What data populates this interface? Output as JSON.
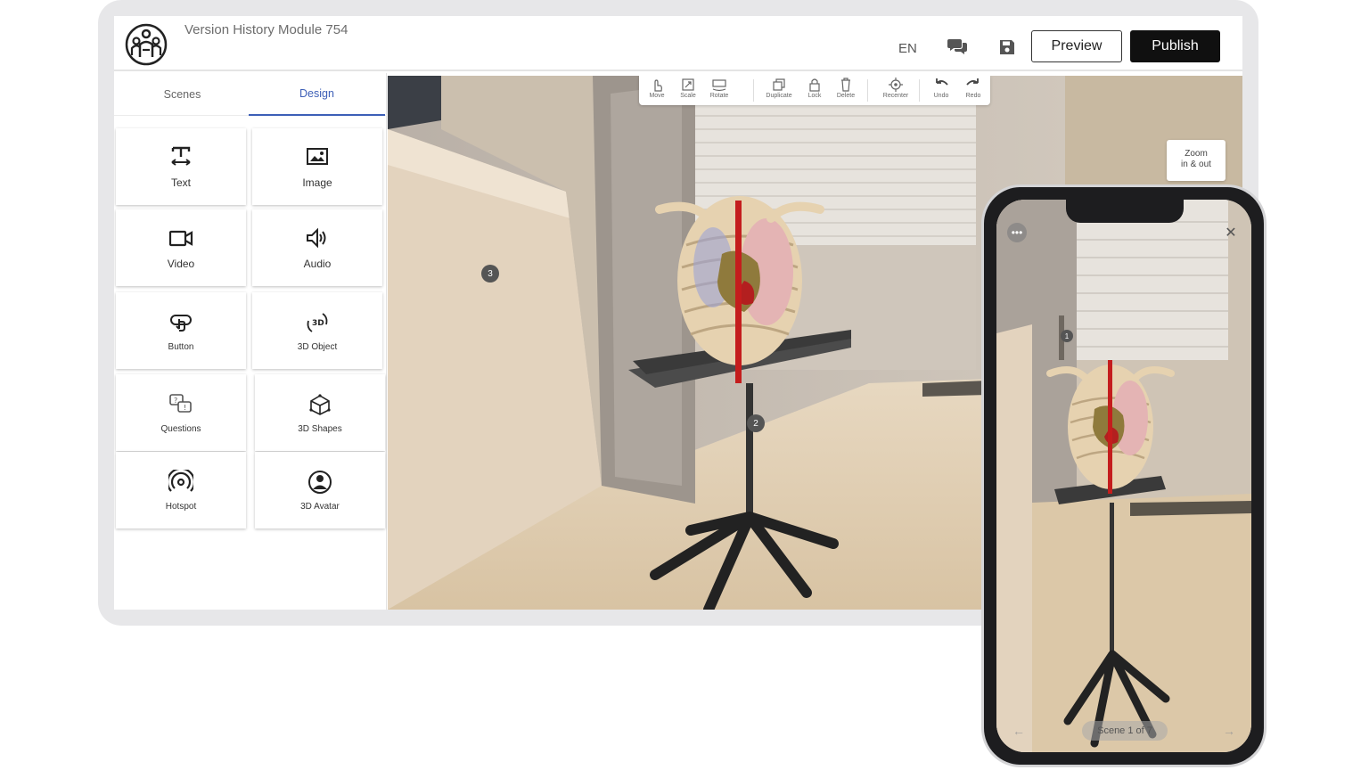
{
  "header": {
    "module_title": "Version History Module 754",
    "language": "EN",
    "preview_label": "Preview",
    "publish_label": "Publish"
  },
  "panel": {
    "tabs": [
      {
        "label": "Scenes",
        "active": false
      },
      {
        "label": "Design",
        "active": true
      }
    ],
    "tiles": [
      {
        "label": "Text",
        "icon": "text-icon"
      },
      {
        "label": "Image",
        "icon": "image-icon"
      },
      {
        "label": "Video",
        "icon": "video-icon"
      },
      {
        "label": "Audio",
        "icon": "audio-icon"
      },
      {
        "label": "Button",
        "icon": "button-icon"
      },
      {
        "label": "3D Object",
        "icon": "3d-object-icon"
      },
      {
        "label": "Questions",
        "icon": "questions-icon"
      },
      {
        "label": "3D Shapes",
        "icon": "3d-shapes-icon"
      },
      {
        "label": "Hotspot",
        "icon": "hotspot-icon"
      },
      {
        "label": "3D Avatar",
        "icon": "3d-avatar-icon"
      }
    ]
  },
  "toolbar": {
    "tools": [
      {
        "label": "Move",
        "icon": "move-icon"
      },
      {
        "label": "Scale",
        "icon": "scale-icon"
      },
      {
        "label": "Rotate",
        "icon": "rotate-icon"
      },
      {
        "label": "Duplicate",
        "icon": "duplicate-icon"
      },
      {
        "label": "Lock",
        "icon": "lock-icon"
      },
      {
        "label": "Delete",
        "icon": "delete-icon"
      },
      {
        "label": "Recenter",
        "icon": "recenter-icon"
      },
      {
        "label": "Undo",
        "icon": "undo-icon"
      },
      {
        "label": "Redo",
        "icon": "redo-icon"
      }
    ]
  },
  "viewport": {
    "zoom_hint_line1": "Zoom",
    "zoom_hint_line2": "in & out",
    "markers": [
      "3",
      "2"
    ]
  },
  "phone": {
    "scene_indicator": "Scene 1 of 7",
    "menu_glyph": "•••",
    "close_glyph": "✕",
    "prev_glyph": "←",
    "next_glyph": "→",
    "marker": "1"
  },
  "colors": {
    "accent": "#3d5fb7",
    "publish_bg": "#101010",
    "frame": "#e7e7e9"
  }
}
